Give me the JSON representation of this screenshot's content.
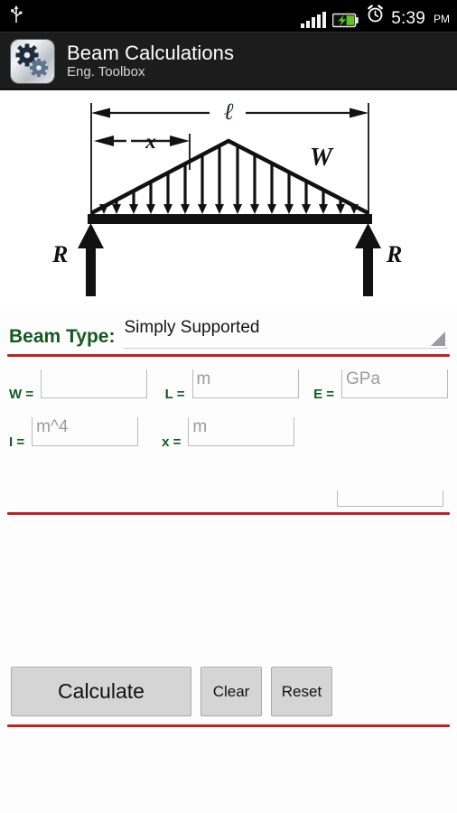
{
  "status_bar": {
    "usb_icon": "usb-icon",
    "signal_icon": "signal-bars-icon",
    "battery_icon": "battery-charging-icon",
    "alarm_icon": "alarm-clock-icon",
    "time": "5:39",
    "meridiem": "PM"
  },
  "action_bar": {
    "app_icon": "gears-app-icon",
    "title": "Beam Calculations",
    "subtitle": "Eng. Toolbox"
  },
  "diagram": {
    "name": "simply-supported-beam-triangular-load-diagram",
    "span_label": "ℓ",
    "distance_label": "x",
    "load_label": "W",
    "reaction_left_label": "R",
    "reaction_right_label": "R"
  },
  "beam_type": {
    "label": "Beam Type:",
    "selected": "Simply Supported"
  },
  "fields": {
    "row1": [
      {
        "name": "w",
        "label": "W =",
        "value": "",
        "placeholder": ""
      },
      {
        "name": "l",
        "label": "L =",
        "value": "",
        "placeholder": "m"
      },
      {
        "name": "e",
        "label": "E =",
        "value": "",
        "placeholder": "GPa"
      }
    ],
    "row2": [
      {
        "name": "i",
        "label": "I =",
        "value": "",
        "placeholder": "m^4"
      },
      {
        "name": "x",
        "label": "x =",
        "value": "",
        "placeholder": "m"
      }
    ]
  },
  "buttons": {
    "calculate": "Calculate",
    "clear": "Clear",
    "reset": "Reset"
  },
  "colors": {
    "label_green": "#14591f",
    "divider_red": "#c02121",
    "action_bar": "#1c1c1c",
    "status_bar": "#000000",
    "button_face": "#d5d5d5",
    "placeholder_gray": "#9b9b9b"
  }
}
